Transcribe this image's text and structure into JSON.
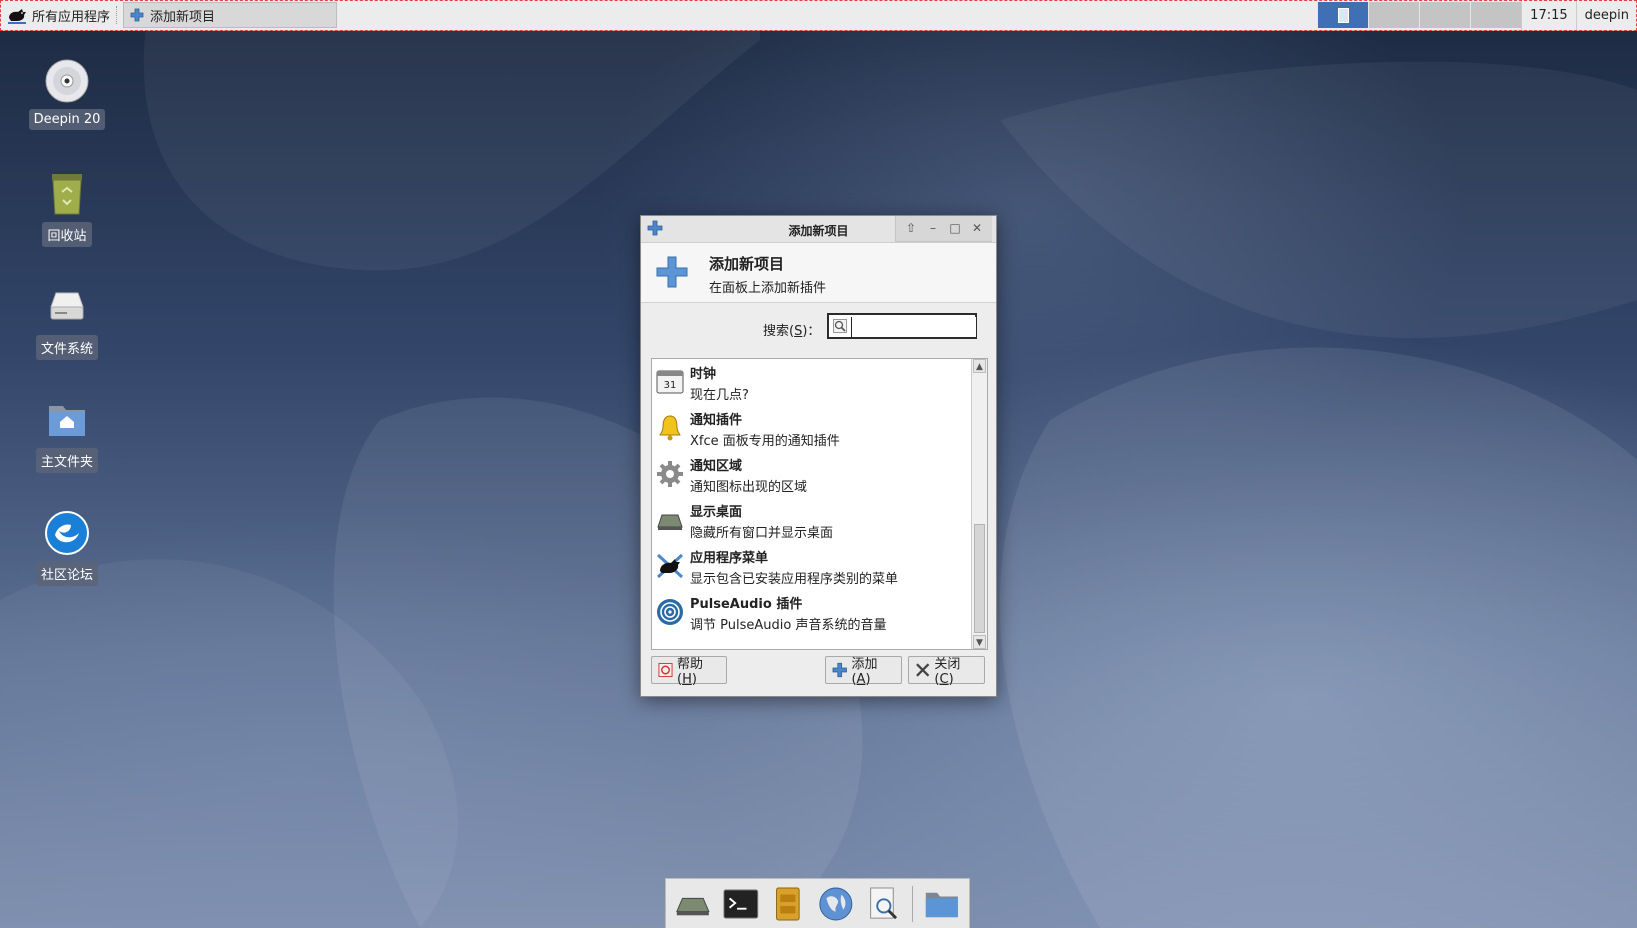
{
  "panel": {
    "apps_label": "所有应用程序",
    "task_label": "添加新项目",
    "clock": "17:15",
    "user": "deepin"
  },
  "desktop": {
    "icons": [
      {
        "label": "Deepin 20",
        "icon": "disc-icon"
      },
      {
        "label": "回收站",
        "icon": "trash-icon"
      },
      {
        "label": "文件系统",
        "icon": "drive-icon"
      },
      {
        "label": "主文件夹",
        "icon": "home-folder-icon"
      },
      {
        "label": "社区论坛",
        "icon": "deepin-logo-icon"
      }
    ]
  },
  "dialog": {
    "title": "添加新项目",
    "header_title": "添加新项目",
    "header_subtitle": "在面板上添加新插件",
    "search_label_pre": "搜索(",
    "search_label_key": "S",
    "search_label_post": ")：",
    "search_value": "",
    "items": [
      {
        "name": "时钟",
        "desc": "现在几点?",
        "icon": "calendar-clock-icon"
      },
      {
        "name": "通知插件",
        "desc": "Xfce 面板专用的通知插件",
        "icon": "bell-icon"
      },
      {
        "name": "通知区域",
        "desc": "通知图标出现的区域",
        "icon": "gear-icon"
      },
      {
        "name": "显示桌面",
        "desc": "隐藏所有窗口并显示桌面",
        "icon": "show-desktop-icon"
      },
      {
        "name": "应用程序菜单",
        "desc": "显示包含已安装应用程序类别的菜单",
        "icon": "xfce-mouse-icon"
      },
      {
        "name": "PulseAudio 插件",
        "desc": "调节 PulseAudio 声音系统的音量",
        "icon": "audio-icon"
      }
    ],
    "help_pre": "帮助(",
    "help_key": "H",
    "help_post": ")",
    "add_pre": "添加(",
    "add_key": "A",
    "add_post": ")",
    "close_pre": "关闭(",
    "close_key": "C",
    "close_post": ")"
  },
  "colors": {
    "accent": "#3f6fb4",
    "wallpaper_top": "#1c2940",
    "wallpaper_bottom": "#7a8bab"
  }
}
